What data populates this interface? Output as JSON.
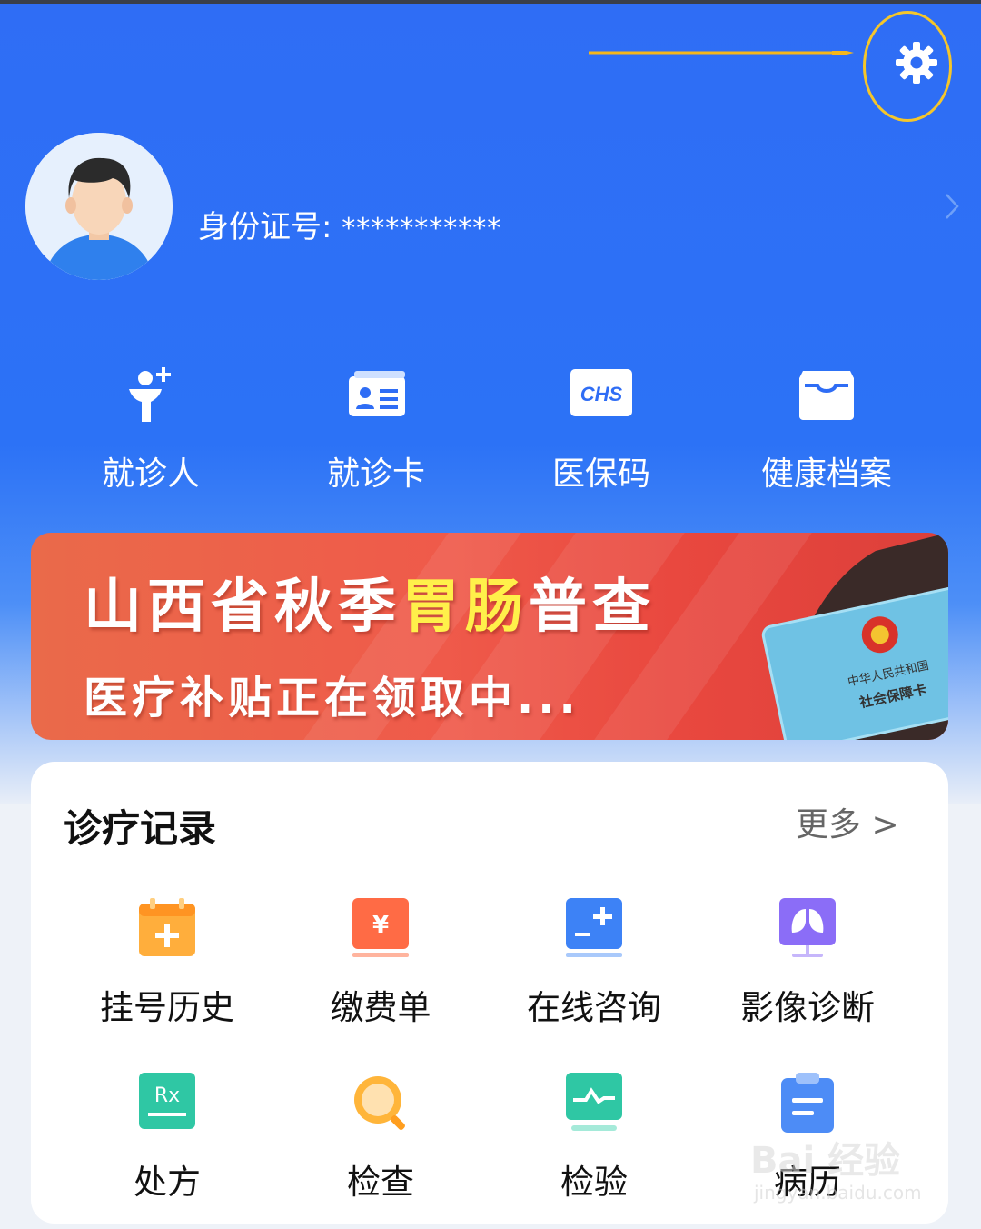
{
  "profile": {
    "id_label": "身份证号:",
    "id_value": "***********"
  },
  "quick_actions": [
    {
      "label": "就诊人",
      "icon": "patient-add-icon"
    },
    {
      "label": "就诊卡",
      "icon": "id-card-icon"
    },
    {
      "label": "医保码",
      "icon": "chs-icon",
      "icon_text": "CHS"
    },
    {
      "label": "健康档案",
      "icon": "archive-tray-icon"
    }
  ],
  "banner": {
    "line1_a": "山西省秋季",
    "line1_highlight": "胃肠",
    "line1_b": "普查",
    "line2": "医疗补贴正在领取中...",
    "card_line1": "中华人民共和国",
    "card_line2": "社会保障卡"
  },
  "records": {
    "title": "诊疗记录",
    "more_label": "更多 >",
    "items": [
      {
        "label": "挂号历史",
        "icon": "calendar-add-icon"
      },
      {
        "label": "缴费单",
        "icon": "payment-yuan-icon",
        "icon_text": "¥"
      },
      {
        "label": "在线咨询",
        "icon": "online-consult-icon"
      },
      {
        "label": "影像诊断",
        "icon": "imaging-lungs-icon"
      },
      {
        "label": "处方",
        "icon": "prescription-rx-icon",
        "icon_text": "Rx"
      },
      {
        "label": "检查",
        "icon": "search-check-icon"
      },
      {
        "label": "检验",
        "icon": "lab-test-wave-icon"
      },
      {
        "label": "病历",
        "icon": "clipboard-record-icon"
      }
    ]
  },
  "watermark": {
    "brand": "Bai 经验",
    "url": "jingyan.baidu.com"
  },
  "colors": {
    "hero_blue": "#2f6df5",
    "banner_red": "#e9483f",
    "highlight_yellow": "#fff04a",
    "annotation_orange": "#f5c62a"
  }
}
